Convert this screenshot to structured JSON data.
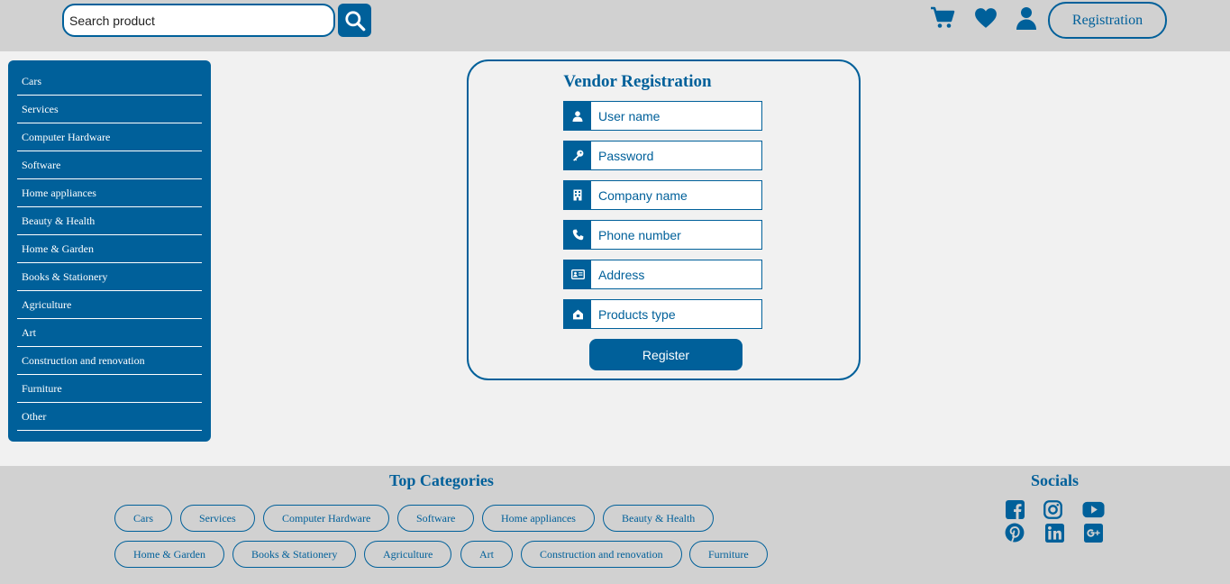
{
  "header": {
    "search_placeholder": "Search product",
    "registration_label": "Registration",
    "icons": [
      "search-icon",
      "cart-icon",
      "heart-icon",
      "user-icon"
    ]
  },
  "sidebar": {
    "items": [
      {
        "label": "Cars"
      },
      {
        "label": "Services"
      },
      {
        "label": "Computer Hardware"
      },
      {
        "label": "Software"
      },
      {
        "label": "Home appliances"
      },
      {
        "label": "Beauty & Health"
      },
      {
        "label": "Home & Garden"
      },
      {
        "label": "Books & Stationery"
      },
      {
        "label": "Agriculture"
      },
      {
        "label": "Art"
      },
      {
        "label": "Construction and renovation"
      },
      {
        "label": "Furniture"
      },
      {
        "label": "Other"
      }
    ]
  },
  "form": {
    "title": "Vendor Registration",
    "fields": [
      {
        "placeholder": "User name",
        "icon": "user-icon"
      },
      {
        "placeholder": "Password",
        "icon": "key-icon"
      },
      {
        "placeholder": "Company name",
        "icon": "building-icon"
      },
      {
        "placeholder": "Phone number",
        "icon": "phone-icon"
      },
      {
        "placeholder": "Address",
        "icon": "address-card-icon"
      },
      {
        "placeholder": "Products type",
        "icon": "store-icon"
      }
    ],
    "register_label": "Register"
  },
  "footer": {
    "top_categories_title": "Top Categories",
    "categories": [
      "Cars",
      "Services",
      "Computer Hardware",
      "Software",
      "Home appliances",
      "Beauty & Health",
      "Home & Garden",
      "Books & Stationery",
      "Agriculture",
      "Art",
      "Construction and renovation",
      "Furniture"
    ],
    "socials_title": "Socials",
    "socials": [
      "facebook-icon",
      "instagram-icon",
      "youtube-icon",
      "pinterest-icon",
      "linkedin-icon",
      "google-plus-icon"
    ]
  },
  "colors": {
    "brand": "#00609a",
    "header_bg": "#d1d1d1",
    "page_bg": "#f1f1f1"
  }
}
